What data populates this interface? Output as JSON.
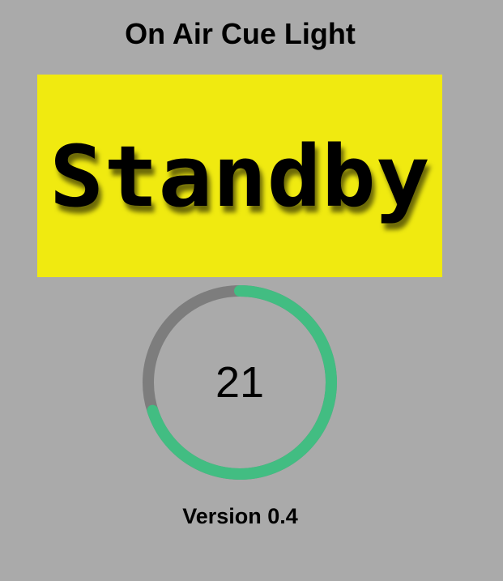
{
  "page": {
    "title": "On Air Cue Light",
    "version": "Version 0.4"
  },
  "status": {
    "label": "Standby",
    "background_color": "#f0ea10",
    "text_color": "#000000"
  },
  "timer": {
    "value": "21",
    "progress": 0.7,
    "track_color": "#7d7d7d",
    "progress_color": "#42bd82"
  }
}
